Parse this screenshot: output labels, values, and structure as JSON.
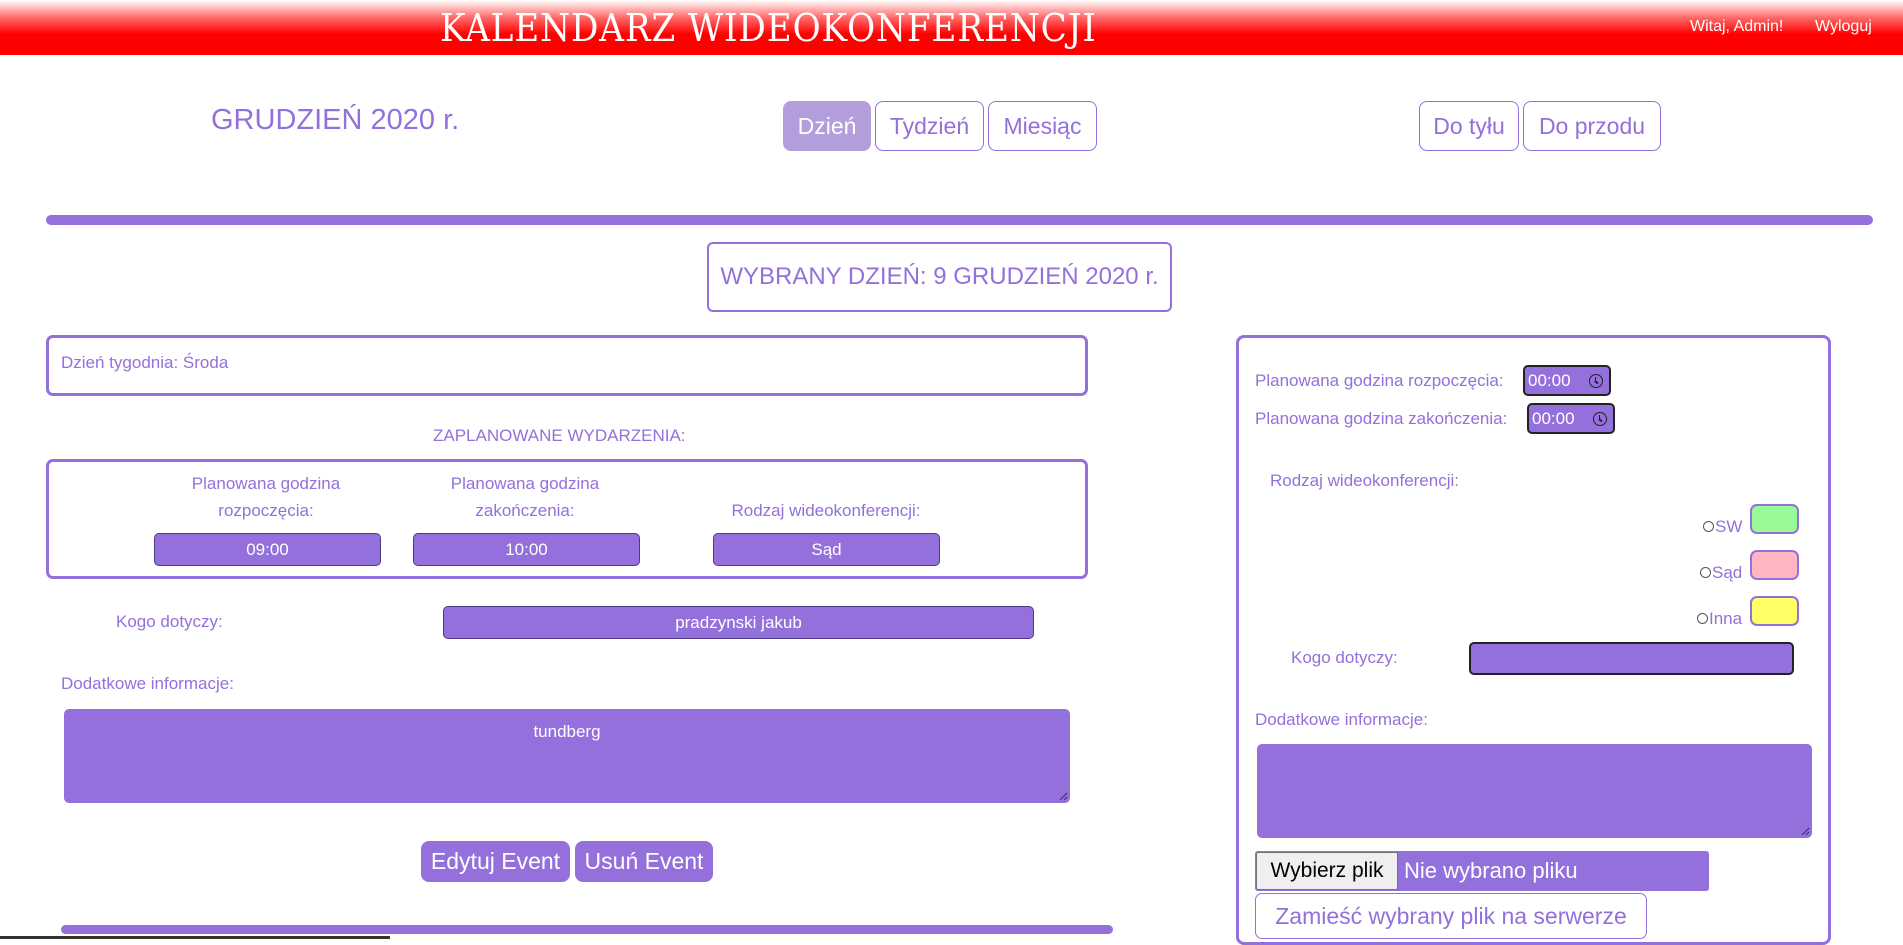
{
  "header": {
    "title": "KALENDARZ WIDEOKONFERENCJI",
    "greeting": "Witaj, Admin!",
    "logout": "Wyloguj"
  },
  "calendar": {
    "month_title": "GRUDZIEŃ 2020 r.",
    "views": [
      "Dzień",
      "Tydzień",
      "Miesiąc"
    ],
    "active_view": "Dzień",
    "back": "Do tyłu",
    "forward": "Do przodu",
    "selected_day": "WYBRANY DZIEŃ: 9 GRUDZIEŃ 2020 r."
  },
  "day": {
    "weekday": "Dzień tygodnia: Środa",
    "planned_heading": "ZAPLANOWANE WYDARZENIA:"
  },
  "event": {
    "start_label": "Planowana godzina rozpoczęcia:",
    "end_label": "Planowana godzina zakończenia:",
    "type_label": "Rodzaj wideokonferencji:",
    "start": "09:00",
    "end": "10:00",
    "type": "Sąd",
    "who_label": "Kogo dotyczy:",
    "who": "pradzynski jakub",
    "info_label": "Dodatkowe informacje:",
    "info": "tundberg",
    "edit": "Edytuj Event",
    "delete": "Usuń Event"
  },
  "form": {
    "start_label": "Planowana godzina rozpoczęcia:",
    "start_value": "00:00",
    "end_label": "Planowana godzina zakończenia:",
    "end_value": "00:00",
    "type_label": "Rodzaj wideokonferencji:",
    "type_options": [
      {
        "label": "SW",
        "color": "#98fb98"
      },
      {
        "label": "Sąd",
        "color": "#ffb6c1"
      },
      {
        "label": "Inna",
        "color": "#ffff66"
      }
    ],
    "who_label": "Kogo dotyczy:",
    "who_value": "",
    "info_label": "Dodatkowe informacje:",
    "info_value": "",
    "file_button": "Wybierz plik",
    "file_status": "Nie wybrano pliku",
    "upload": "Zamieść wybrany plik na serwerze"
  },
  "colors": {
    "accent": "#9370db",
    "header_red": "#ff0000",
    "active_tab": "#b39ddb"
  }
}
